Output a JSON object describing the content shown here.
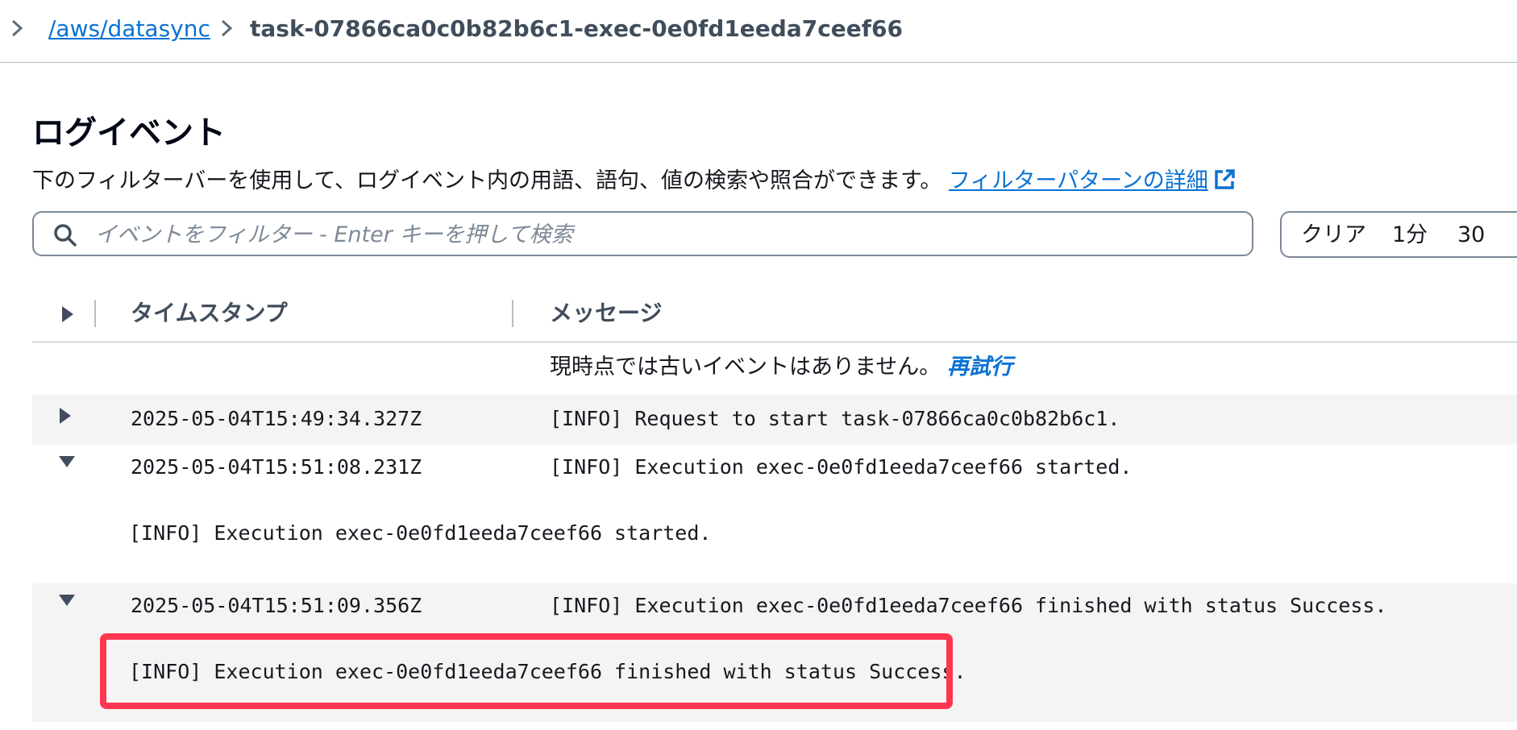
{
  "breadcrumb": {
    "parent": "/aws/datasync",
    "current": "task-07866ca0c0b82b6c1-exec-0e0fd1eeda7ceef66"
  },
  "header": {
    "title": "ログイベント",
    "description": "下のフィルターバーを使用して、ログイベント内の用語、語句、値の検索や照合ができます。",
    "learn_more": "フィルターパターンの詳細"
  },
  "filter": {
    "placeholder": "イベントをフィルター - Enter キーを押して検索",
    "segments": [
      "クリア",
      "1分",
      "30"
    ]
  },
  "table": {
    "columns": {
      "timestamp": "タイムスタンプ",
      "message": "メッセージ"
    },
    "notice": "現時点では古いイベントはありません。",
    "retry": "再試行",
    "rows": [
      {
        "timestamp": "2025-05-04T15:49:34.327Z",
        "message": "[INFO] Request to start task-07866ca0c0b82b6c1.",
        "expanded": false
      },
      {
        "timestamp": "2025-05-04T15:51:08.231Z",
        "message": "[INFO] Execution exec-0e0fd1eeda7ceef66 started.",
        "expanded": true,
        "detail": "[INFO] Execution exec-0e0fd1eeda7ceef66 started."
      },
      {
        "timestamp": "2025-05-04T15:51:09.356Z",
        "message": "[INFO] Execution exec-0e0fd1eeda7ceef66 finished with status Success.",
        "expanded": true,
        "detail": "[INFO] Execution exec-0e0fd1eeda7ceef66 finished with status Success."
      }
    ]
  },
  "colors": {
    "link": "#0972d3",
    "highlight": "#ff3650",
    "row_shade": "#f4f4f4"
  },
  "icons": {
    "breadcrumb_separator": "chevron-right-icon",
    "external": "external-link-icon",
    "search": "search-icon",
    "collapsed": "caret-right-icon",
    "expanded": "caret-down-icon"
  }
}
